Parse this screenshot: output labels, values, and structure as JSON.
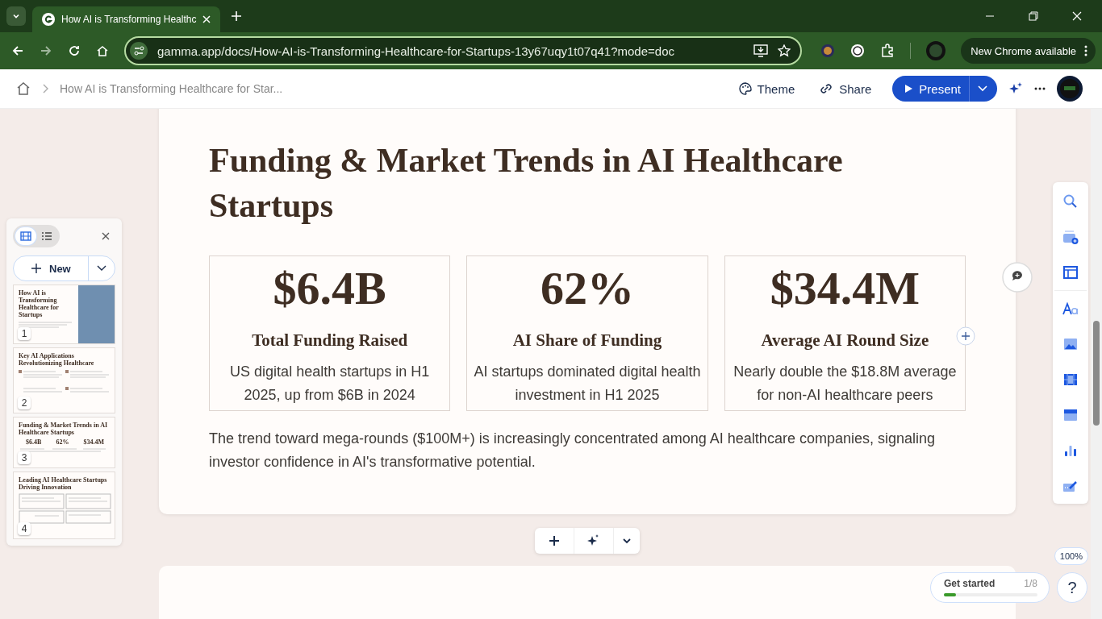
{
  "browser": {
    "tab": {
      "title": "How AI is Transforming Healthc"
    },
    "url": "gamma.app/docs/How-AI-is-Transforming-Healthcare-for-Startups-13y67uqy1t07q41?mode=doc",
    "update_button": "New Chrome available"
  },
  "app_header": {
    "breadcrumb": "How AI is Transforming Healthcare for Star...",
    "actions": [
      {
        "kind": "theme",
        "label": "Theme"
      },
      {
        "kind": "share",
        "label": "Share"
      }
    ],
    "present_button": "Present"
  },
  "outline_panel": {
    "views": [
      {
        "kind": "cards",
        "selected": true
      },
      {
        "kind": "list",
        "selected": false
      }
    ],
    "new_button": "New",
    "slides": [
      {
        "number": "1",
        "title": "How AI is Transforming Healthcare for Startups",
        "kind": "image"
      },
      {
        "number": "2",
        "title": "Key AI Applications Revolutionizing Healthcare",
        "kind": "grid"
      },
      {
        "number": "3",
        "title": "Funding & Market Trends in AI Healthcare Startups",
        "kind": "stats",
        "stats": [
          "$6.4B",
          "62%",
          "$34.4M"
        ]
      },
      {
        "number": "4",
        "title": "Leading AI Healthcare Startups Driving Innovation",
        "kind": "boxes"
      }
    ]
  },
  "card": {
    "title": "Funding & Market Trends in AI Healthcare Startups",
    "stats": [
      {
        "value": "$6.4B",
        "label": "Total Funding Raised",
        "description": "US digital health startups in H1 2025, up from $6B in 2024"
      },
      {
        "value": "62%",
        "label": "AI Share of Funding",
        "description": "AI startups dominated digital health investment in H1 2025"
      },
      {
        "value": "$34.4M",
        "label": "Average AI Round Size",
        "description": "Nearly double the $18.8M average for non-AI healthcare peers"
      }
    ],
    "paragraph": "The trend toward mega-rounds ($100M+) is increasingly concentrated among AI healthcare companies, signaling investor confidence in AI's transformative potential."
  },
  "zoom_level": "100%",
  "get_started": {
    "label": "Get started",
    "count": "1/8",
    "level": 0.125
  },
  "help_button": "?"
}
